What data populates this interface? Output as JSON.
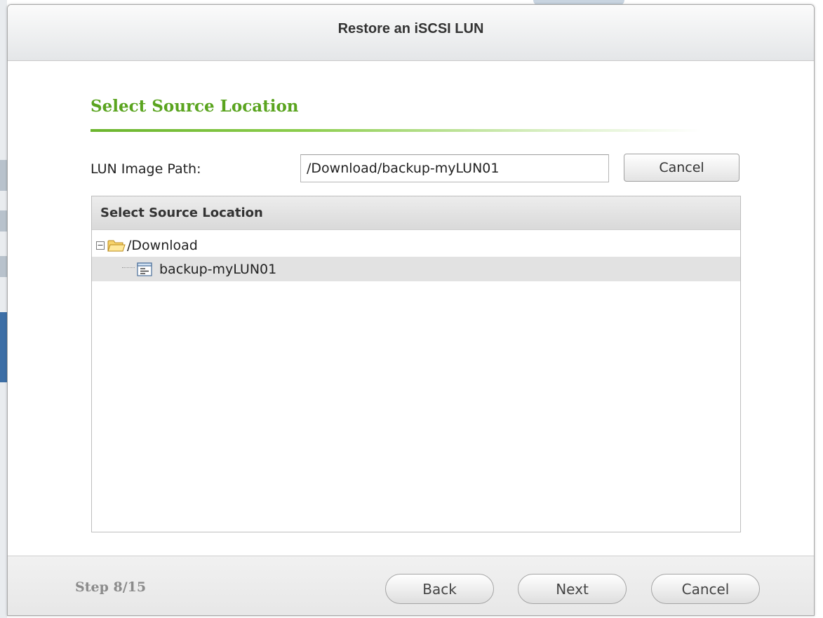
{
  "dialog": {
    "title": "Restore an iSCSI LUN"
  },
  "section": {
    "title": "Select Source Location"
  },
  "lun_path": {
    "label": "LUN Image Path:",
    "value": "/Download/backup-myLUN01",
    "cancel_label": "Cancel"
  },
  "tree": {
    "header": "Select Source Location",
    "root": {
      "label": "/Download",
      "expanded": true,
      "icon": "folder-icon"
    },
    "children": [
      {
        "label": "backup-myLUN01",
        "selected": true,
        "icon": "file-icon"
      }
    ]
  },
  "footer": {
    "step_text": "Step 8/15",
    "back_label": "Back",
    "next_label": "Next",
    "cancel_label": "Cancel"
  },
  "colors": {
    "accent_green": "#5aa41f",
    "selected_row": "#e2e2e2",
    "step_text": "#8b8b8b"
  }
}
